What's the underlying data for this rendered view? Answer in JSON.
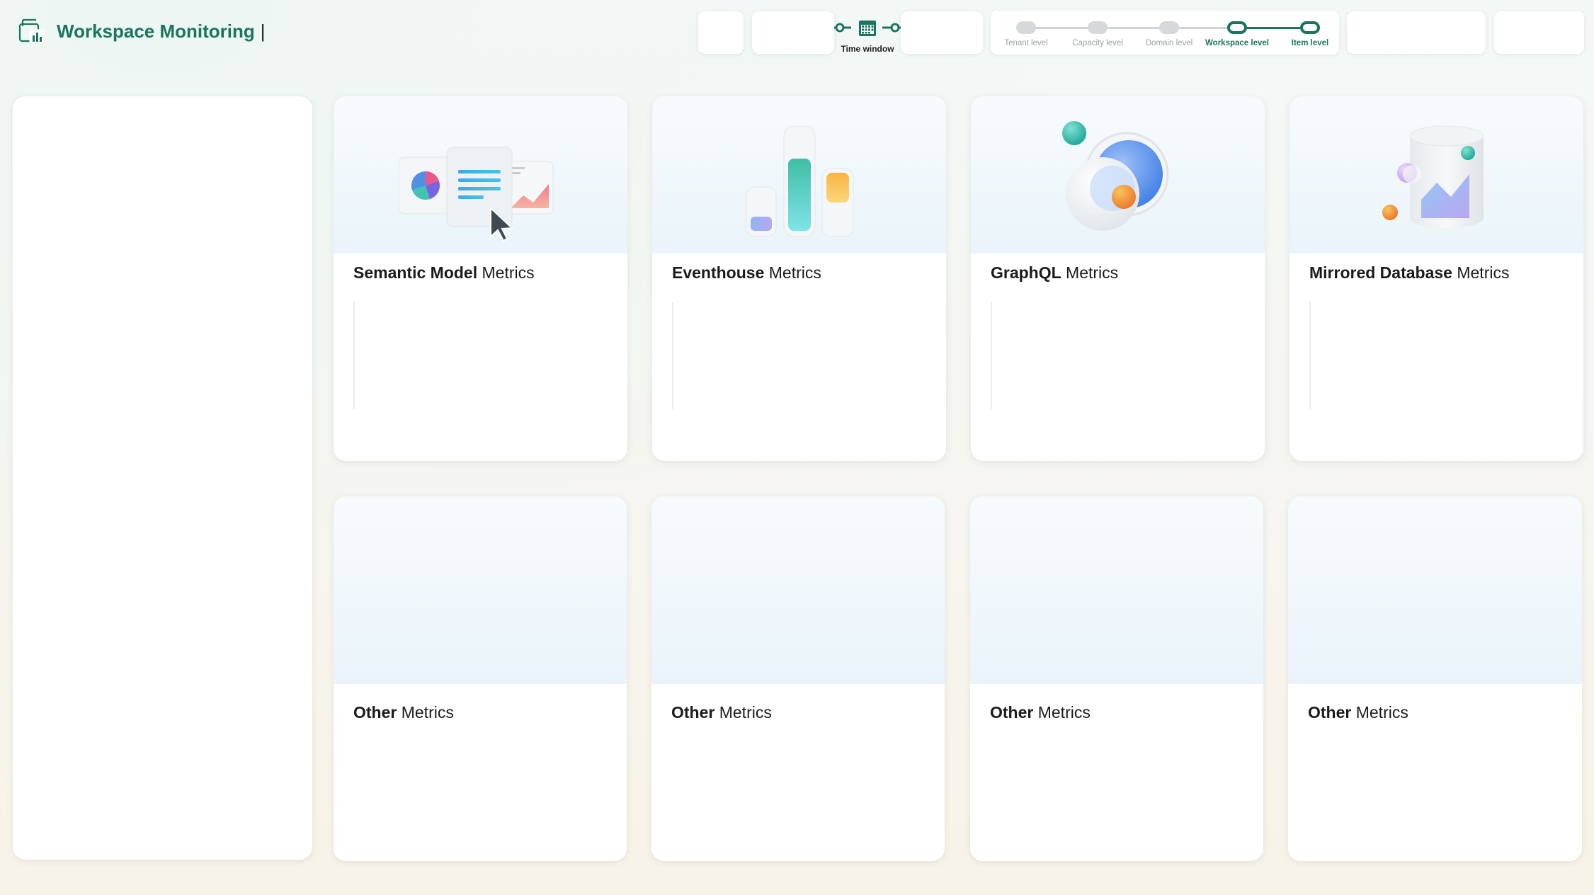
{
  "header": {
    "title": "Workspace Monitoring",
    "title_cursor": "|",
    "app_icon": "report-workspace-icon",
    "time_window_label": "Time window",
    "time_window_icon": "calendar-icon"
  },
  "levels": {
    "items": [
      {
        "label": "Tenant level",
        "active": false
      },
      {
        "label": "Capacity level",
        "active": false
      },
      {
        "label": "Domain level",
        "active": false
      },
      {
        "label": "Workspace level",
        "active": true
      },
      {
        "label": "Item level",
        "active": true
      }
    ],
    "accent": "#1a7560"
  },
  "cards": {
    "semantic": {
      "bold": "Semantic Model",
      "rest": " Metrics",
      "illustration": "report-documents-icon"
    },
    "eventhouse": {
      "bold": "Eventhouse",
      "rest": " Metrics",
      "illustration": "bar-columns-icon"
    },
    "graphql": {
      "bold": "GraphQL",
      "rest": " Metrics",
      "illustration": "spheres-icon"
    },
    "mirrored": {
      "bold": "Mirrored Database",
      "rest": " Metrics",
      "illustration": "database-chart-icon"
    },
    "other1": {
      "bold": "Other",
      "rest": " Metrics"
    },
    "other2": {
      "bold": "Other",
      "rest": " Metrics"
    },
    "other3": {
      "bold": "Other",
      "rest": " Metrics"
    },
    "other4": {
      "bold": "Other",
      "rest": " Metrics"
    }
  },
  "colors": {
    "brand": "#1a7560",
    "card_hero": "#eaf4fa"
  }
}
